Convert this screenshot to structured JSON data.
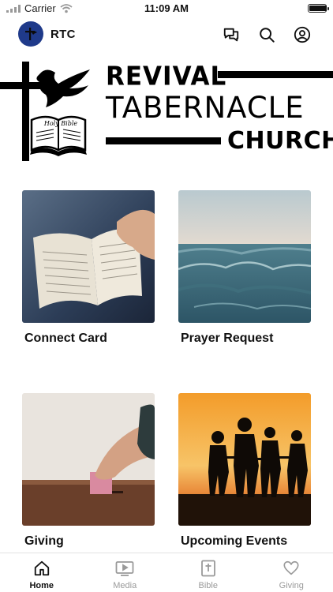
{
  "status_bar": {
    "carrier": "Carrier",
    "time": "11:09 AM",
    "battery_level": 1.0
  },
  "app": {
    "title": "RTC"
  },
  "logo": {
    "line1": "REVIVAL",
    "line2": "TABERNACLE",
    "line3": "CHURCH",
    "book_text": "Holy Bible"
  },
  "tiles": [
    {
      "label": "Connect Card"
    },
    {
      "label": "Prayer Request"
    },
    {
      "label": "Giving"
    },
    {
      "label": "Upcoming Events"
    }
  ],
  "nav": {
    "items": [
      {
        "label": "Home",
        "icon": "home-icon",
        "active": true
      },
      {
        "label": "Media",
        "icon": "play-icon",
        "active": false
      },
      {
        "label": "Bible",
        "icon": "bible-icon",
        "active": false
      },
      {
        "label": "Giving",
        "icon": "heart-icon",
        "active": false
      }
    ]
  },
  "colors": {
    "avatar_bg": "#1f3a8a",
    "inactive": "#9a9a9a",
    "active": "#111111"
  }
}
